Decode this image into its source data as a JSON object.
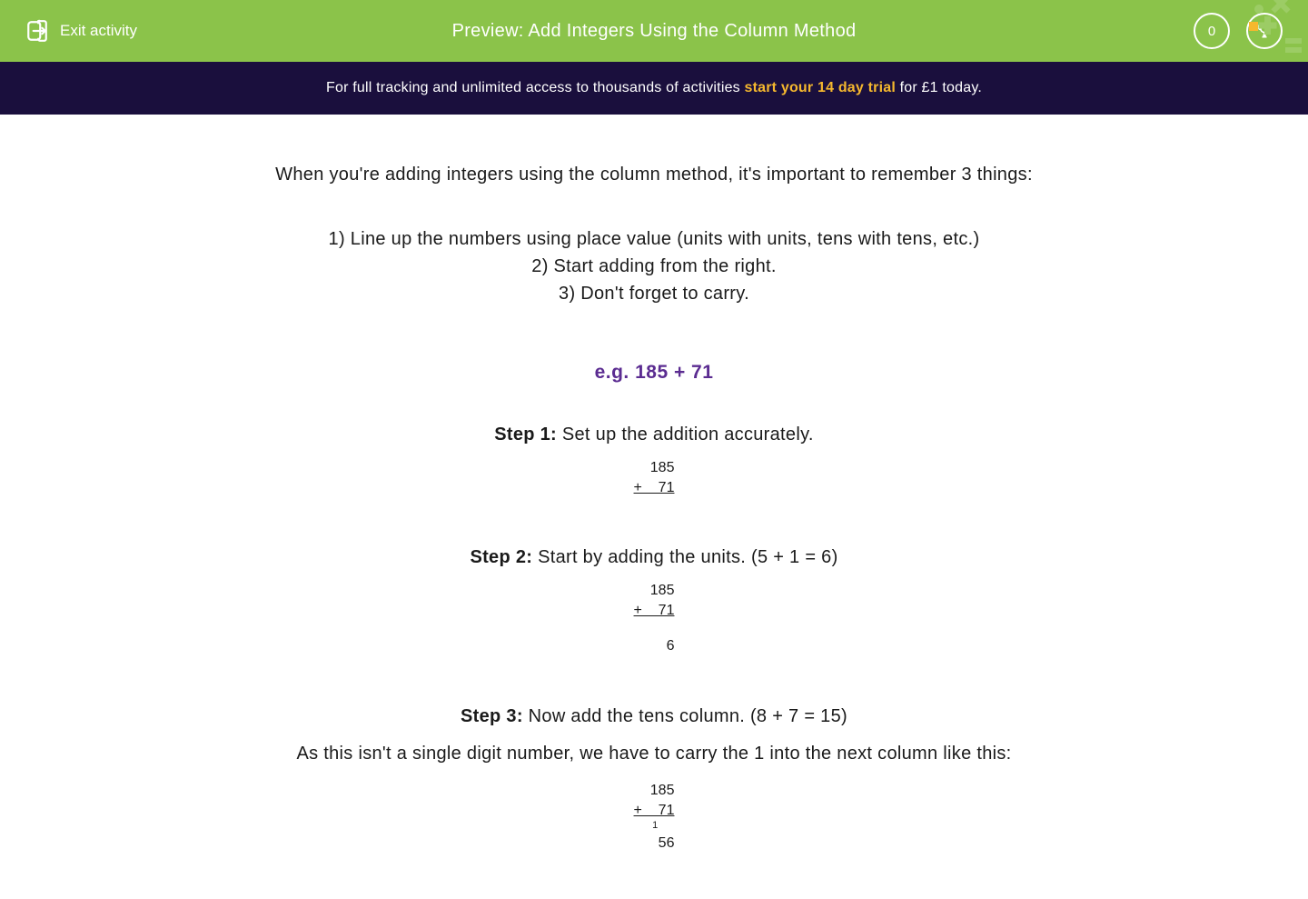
{
  "header": {
    "exit_label": "Exit activity",
    "title": "Preview: Add Integers Using the Column Method",
    "score": "0"
  },
  "promo": {
    "prefix": "For full tracking and unlimited access to thousands of activities ",
    "bold": "start your 14 day trial",
    "suffix": " for £1 today."
  },
  "content": {
    "intro": "When you're adding integers using the column method, it's important to remember 3 things:",
    "rule1": "1) Line up the numbers using place value (units with units, tens with tens, etc.)",
    "rule2": "2) Start adding from the right.",
    "rule3": "3) Don't forget to carry.",
    "example_heading": "e.g. 185 + 71",
    "step1": {
      "label": "Step 1:",
      "text": " Set up the addition accurately.",
      "row1": "185",
      "row2": "+  71"
    },
    "step2": {
      "label": "Step 2:",
      "text": " Start by adding the units. (5 + 1 = 6)",
      "row1": "185",
      "row2": "+  71",
      "result": "6"
    },
    "step3": {
      "label": "Step 3:",
      "text": " Now add the tens column. (8 + 7 = 15)",
      "explain": "As this isn't a single digit number, we have to carry the 1 into the next column like this:",
      "row1": "185",
      "row2": "+  71",
      "carry": "1  ",
      "result": "56"
    }
  }
}
